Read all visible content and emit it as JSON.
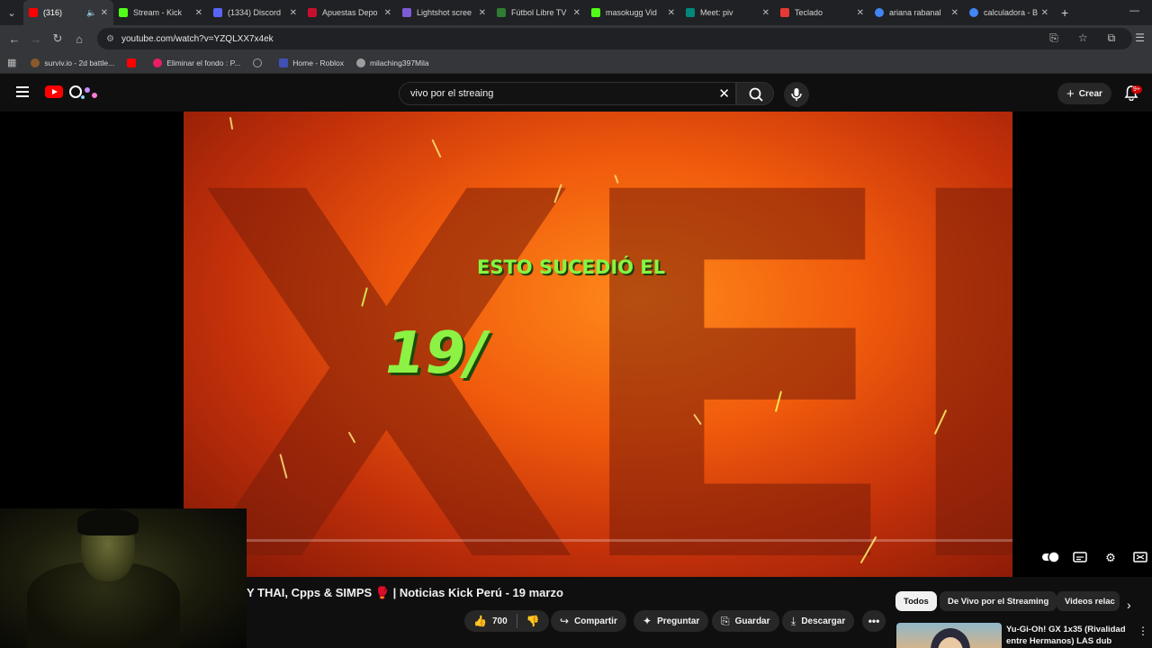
{
  "browser": {
    "tabs": [
      {
        "title": "(316)",
        "color": "#ff0000"
      },
      {
        "title": "Stream - Kick",
        "color": "#53fc18"
      },
      {
        "title": "(1334) Discord",
        "color": "#5865f2"
      },
      {
        "title": "Apuestas Depo",
        "color": "#c8102e"
      },
      {
        "title": "Lightshot scree",
        "color": "#7b5cd6"
      },
      {
        "title": "Fútbol Libre TV",
        "color": "#2e7d32"
      },
      {
        "title": "masokugg Vid",
        "color": "#53fc18"
      },
      {
        "title": "Meet: piv",
        "color": "#00897b"
      },
      {
        "title": "Teclado",
        "color": "#e53935"
      },
      {
        "title": "ariana rabanal",
        "color": "#4285f4"
      },
      {
        "title": "calculadora - B",
        "color": "#4285f4"
      }
    ],
    "url": "youtube.com/watch?v=YZQLXX7x4ek",
    "bookmarks": [
      {
        "label": "surviv.io - 2d battle...",
        "color": "#8b5a2b"
      },
      {
        "label": "",
        "color": "#ff0000"
      },
      {
        "label": "Eliminar el fondo : P...",
        "color": "#e91e63"
      },
      {
        "label": "",
        "color": "#9e9e9e"
      },
      {
        "label": "Home - Roblox",
        "color": "#3f51b5"
      },
      {
        "label": "milaching397Mila",
        "color": "#9e9e9e"
      }
    ]
  },
  "youtube": {
    "search_value": "vivo por el streaing",
    "create_label": "Crear",
    "notif_count": "9+"
  },
  "video": {
    "overlay_line1": "ESTO SUCEDIÓ EL",
    "overlay_line2": "19/",
    "bg_text": "XELS",
    "title": "Y THAI, Cpps & SIMPS 🥊 | Noticias Kick Perú - 19 marzo",
    "likes": "700",
    "actions": {
      "share": "Compartir",
      "ask": "Preguntar",
      "save": "Guardar",
      "download": "Descargar"
    }
  },
  "sidebar": {
    "chips": [
      "Todos",
      "De Vivo por el Streaming",
      "Videos relac"
    ],
    "recommended": {
      "title": "Yu-Gi-Oh! GX 1x35 (Rivalidad entre Hermanos) LAS dub"
    }
  }
}
